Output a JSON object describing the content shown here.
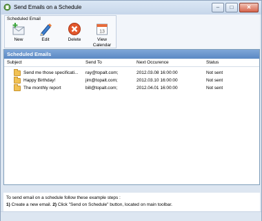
{
  "window": {
    "title": "Send Emails on a Schedule"
  },
  "toolbar": {
    "group_label": "Scheduled Email",
    "buttons": [
      {
        "label": "New",
        "icon": "new-email-icon"
      },
      {
        "label": "Edit",
        "icon": "pencil-icon"
      },
      {
        "label": "Delete",
        "icon": "delete-icon"
      },
      {
        "label": "View\nCalendar",
        "icon": "calendar-icon"
      }
    ],
    "calendar_day": "13"
  },
  "panel": {
    "title": "Scheduled Emails",
    "columns": [
      "Subject",
      "Send To",
      "Next Occurence",
      "Status"
    ],
    "rows": [
      {
        "subject": "Send me those specificati...",
        "send_to": "ray@topalt.com;",
        "next": "2012.03.08 16:00:00",
        "status": "Not sent"
      },
      {
        "subject": "Happy Birthday!",
        "send_to": "jim@topalt.com;",
        "next": "2012.03.10 16:00:00",
        "status": "Not sent"
      },
      {
        "subject": "The monthly report",
        "send_to": "bill@topalt.com;",
        "next": "2012.04.01 16:00:00",
        "status": "Not sent"
      }
    ]
  },
  "info": {
    "line1": "To send email on a schedule follow these example steps :",
    "step1_num": "1)",
    "step1_text": "Create a new email.",
    "step2_num": "2)",
    "step2_text": "Click \"Send on Schedule\" button, located on main toolbar."
  },
  "colors": {
    "header_blue": "#5a88c4",
    "window_bg": "#dde6f1"
  }
}
